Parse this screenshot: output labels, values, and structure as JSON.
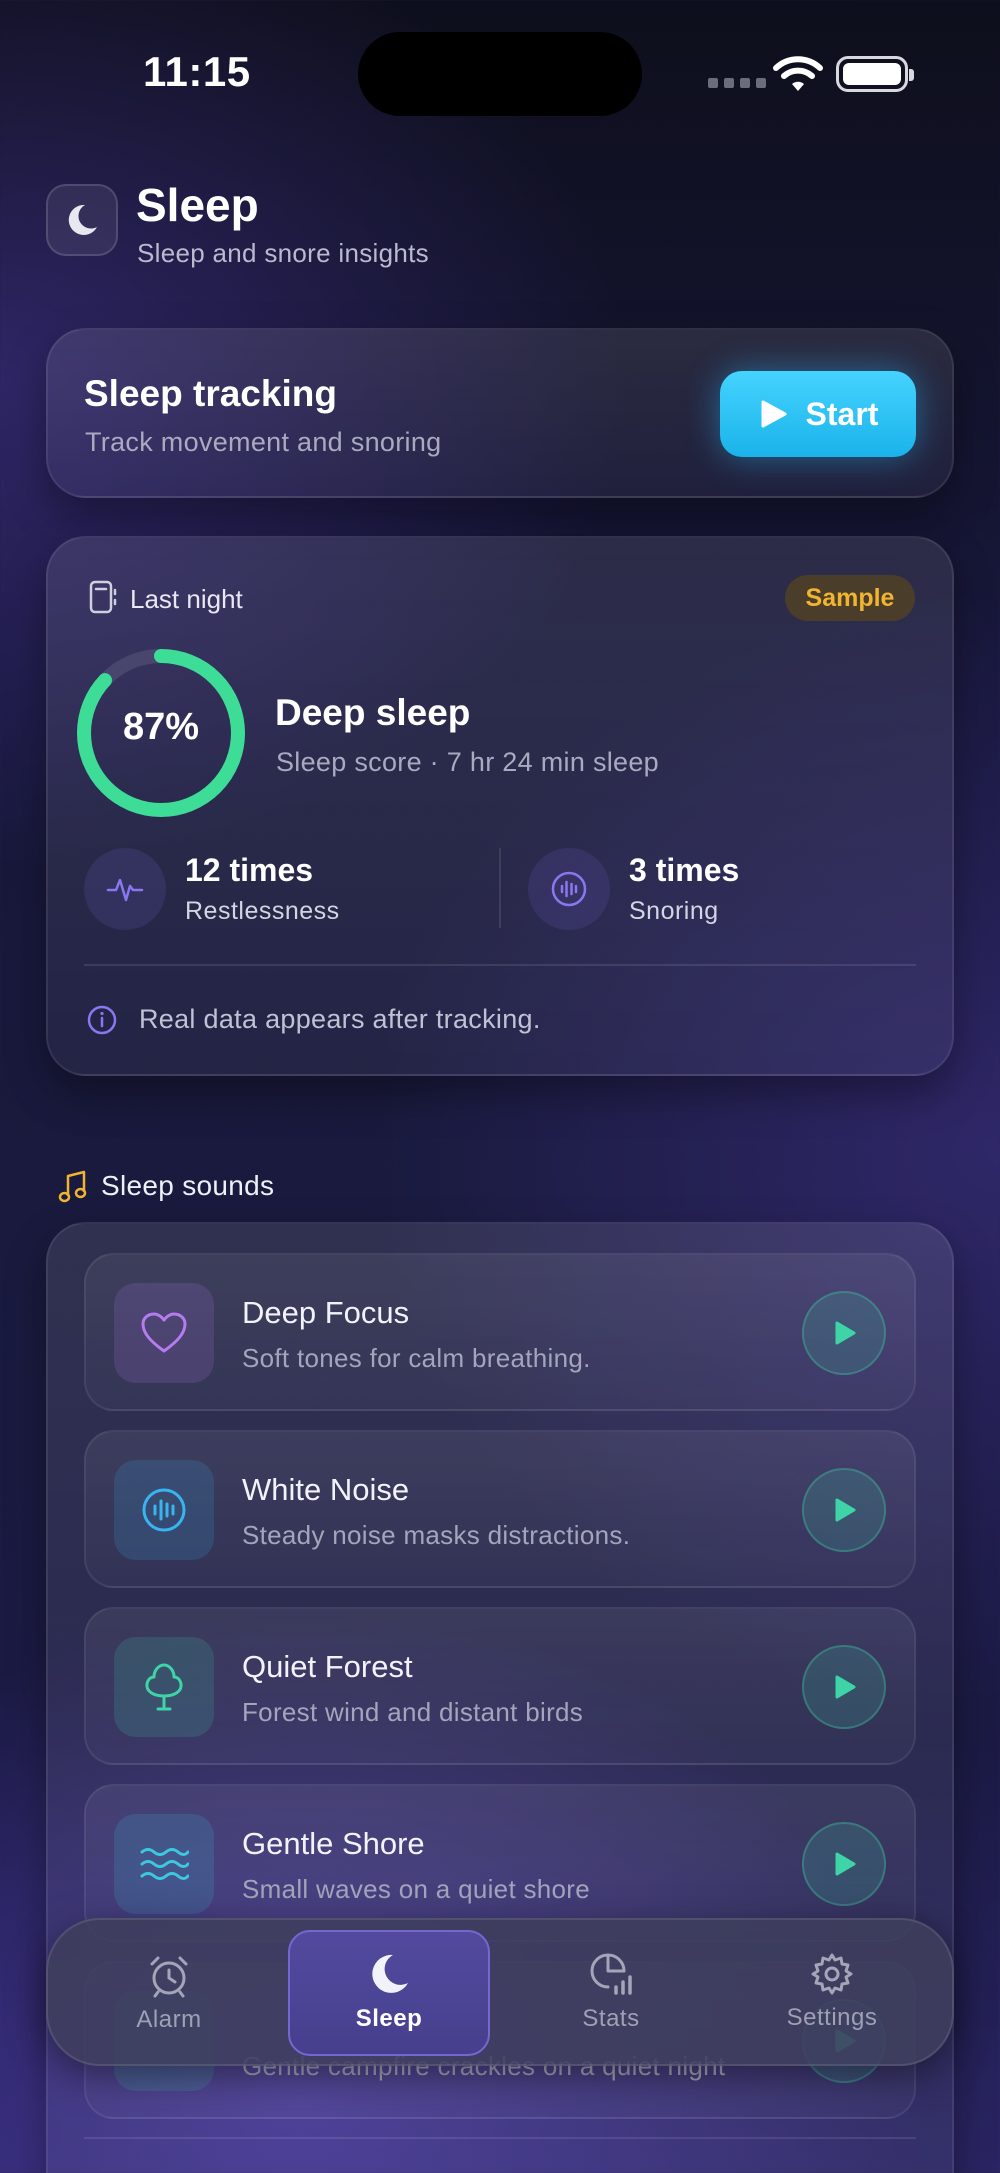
{
  "status_bar": {
    "time": "11:15"
  },
  "header": {
    "title": "Sleep",
    "subtitle": "Sleep and snore insights"
  },
  "tracking": {
    "title": "Sleep tracking",
    "subtitle": "Track movement and snoring",
    "start_label": "Start"
  },
  "last_night": {
    "label": "Last night",
    "badge": "Sample",
    "score": "87%",
    "score_fraction": 0.87,
    "title": "Deep sleep",
    "subtitle": "Sleep score · 7 hr 24 min sleep",
    "stats": [
      {
        "value": "12 times",
        "label": "Restlessness",
        "icon": "pulse-icon"
      },
      {
        "value": "3 times",
        "label": "Snoring",
        "icon": "sound-wave-icon"
      }
    ],
    "info": "Real data appears after tracking."
  },
  "sounds": {
    "heading": "Sleep sounds",
    "items": [
      {
        "title": "Deep Focus",
        "description": "Soft tones for calm breathing.",
        "icon": "heart-icon",
        "color": "#b57cf0"
      },
      {
        "title": "White Noise",
        "description": "Steady noise masks distractions.",
        "icon": "sound-wave-icon",
        "color": "#39b4f0"
      },
      {
        "title": "Quiet Forest",
        "description": "Forest wind and distant birds",
        "icon": "tree-icon",
        "color": "#3fd3a8"
      },
      {
        "title": "Gentle Shore",
        "description": "Small waves on a quiet shore",
        "icon": "waves-icon",
        "color": "#3cc8e0"
      },
      {
        "title": "",
        "description": "Gentle campfire crackles on a quiet night",
        "icon": "fire-icon",
        "color": "#3fd3a8"
      }
    ]
  },
  "tab_bar": {
    "tabs": [
      {
        "label": "Alarm",
        "icon": "alarm-clock-icon"
      },
      {
        "label": "Sleep",
        "icon": "moon-icon",
        "active": true
      },
      {
        "label": "Stats",
        "icon": "chart-icon"
      },
      {
        "label": "Settings",
        "icon": "gear-icon"
      }
    ]
  },
  "colors": {
    "accent": "#2ec5f5",
    "ring": "#3ddc97",
    "badge": "#f0b431",
    "active_tab": "#534a9e"
  }
}
